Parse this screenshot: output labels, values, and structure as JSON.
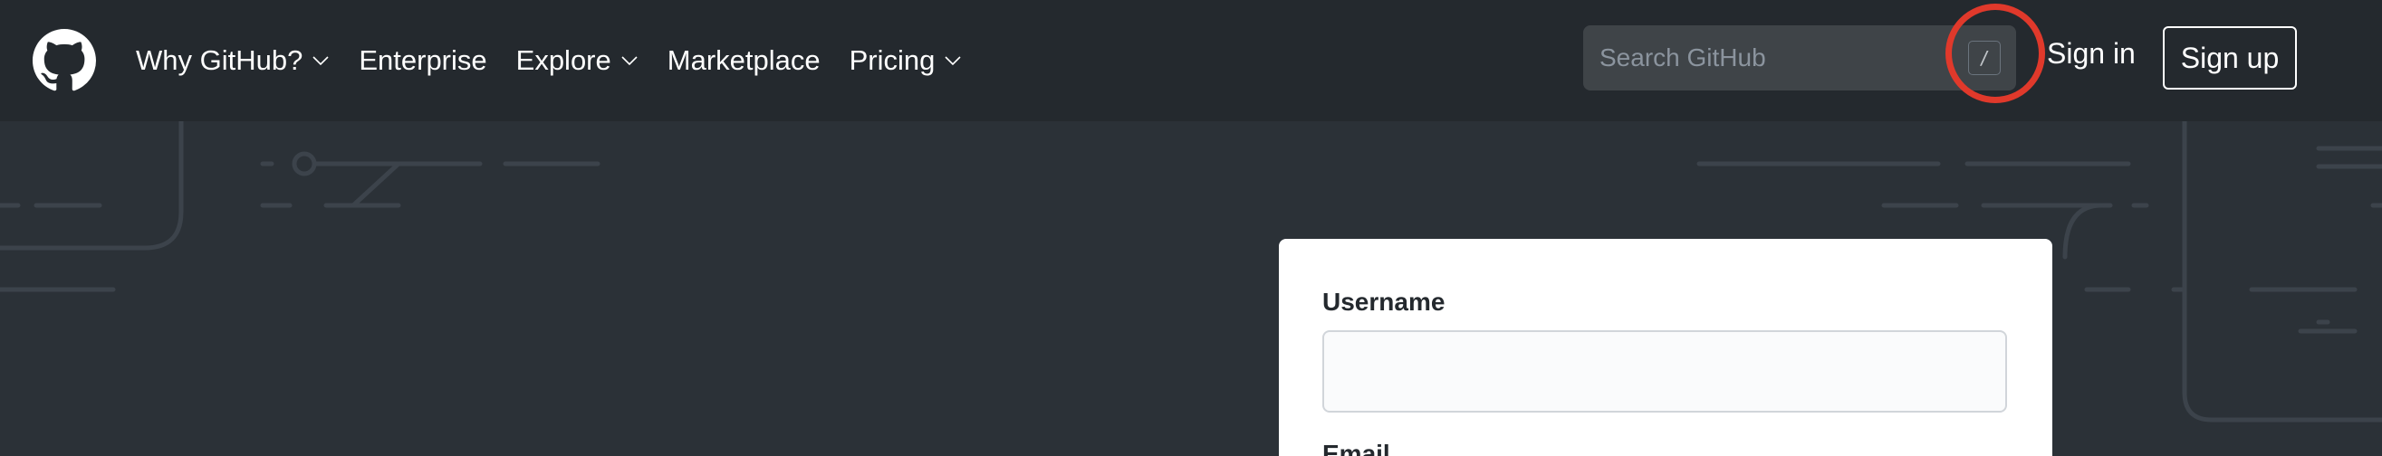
{
  "header": {
    "logo_icon": "github-octocat-icon",
    "nav": [
      {
        "label": "Why GitHub?",
        "has_dropdown": true
      },
      {
        "label": "Enterprise",
        "has_dropdown": false
      },
      {
        "label": "Explore",
        "has_dropdown": true
      },
      {
        "label": "Marketplace",
        "has_dropdown": false
      },
      {
        "label": "Pricing",
        "has_dropdown": true
      }
    ],
    "search": {
      "placeholder": "Search GitHub",
      "shortcut_key": "/"
    },
    "signin_label": "Sign in",
    "signup_label": "Sign up"
  },
  "form": {
    "username_label": "Username",
    "username_value": "",
    "email_label": "Email"
  },
  "colors": {
    "header_bg": "#24292e",
    "page_bg": "#2b3137",
    "highlight_ring": "#e0392b",
    "card_bg": "#ffffff"
  }
}
